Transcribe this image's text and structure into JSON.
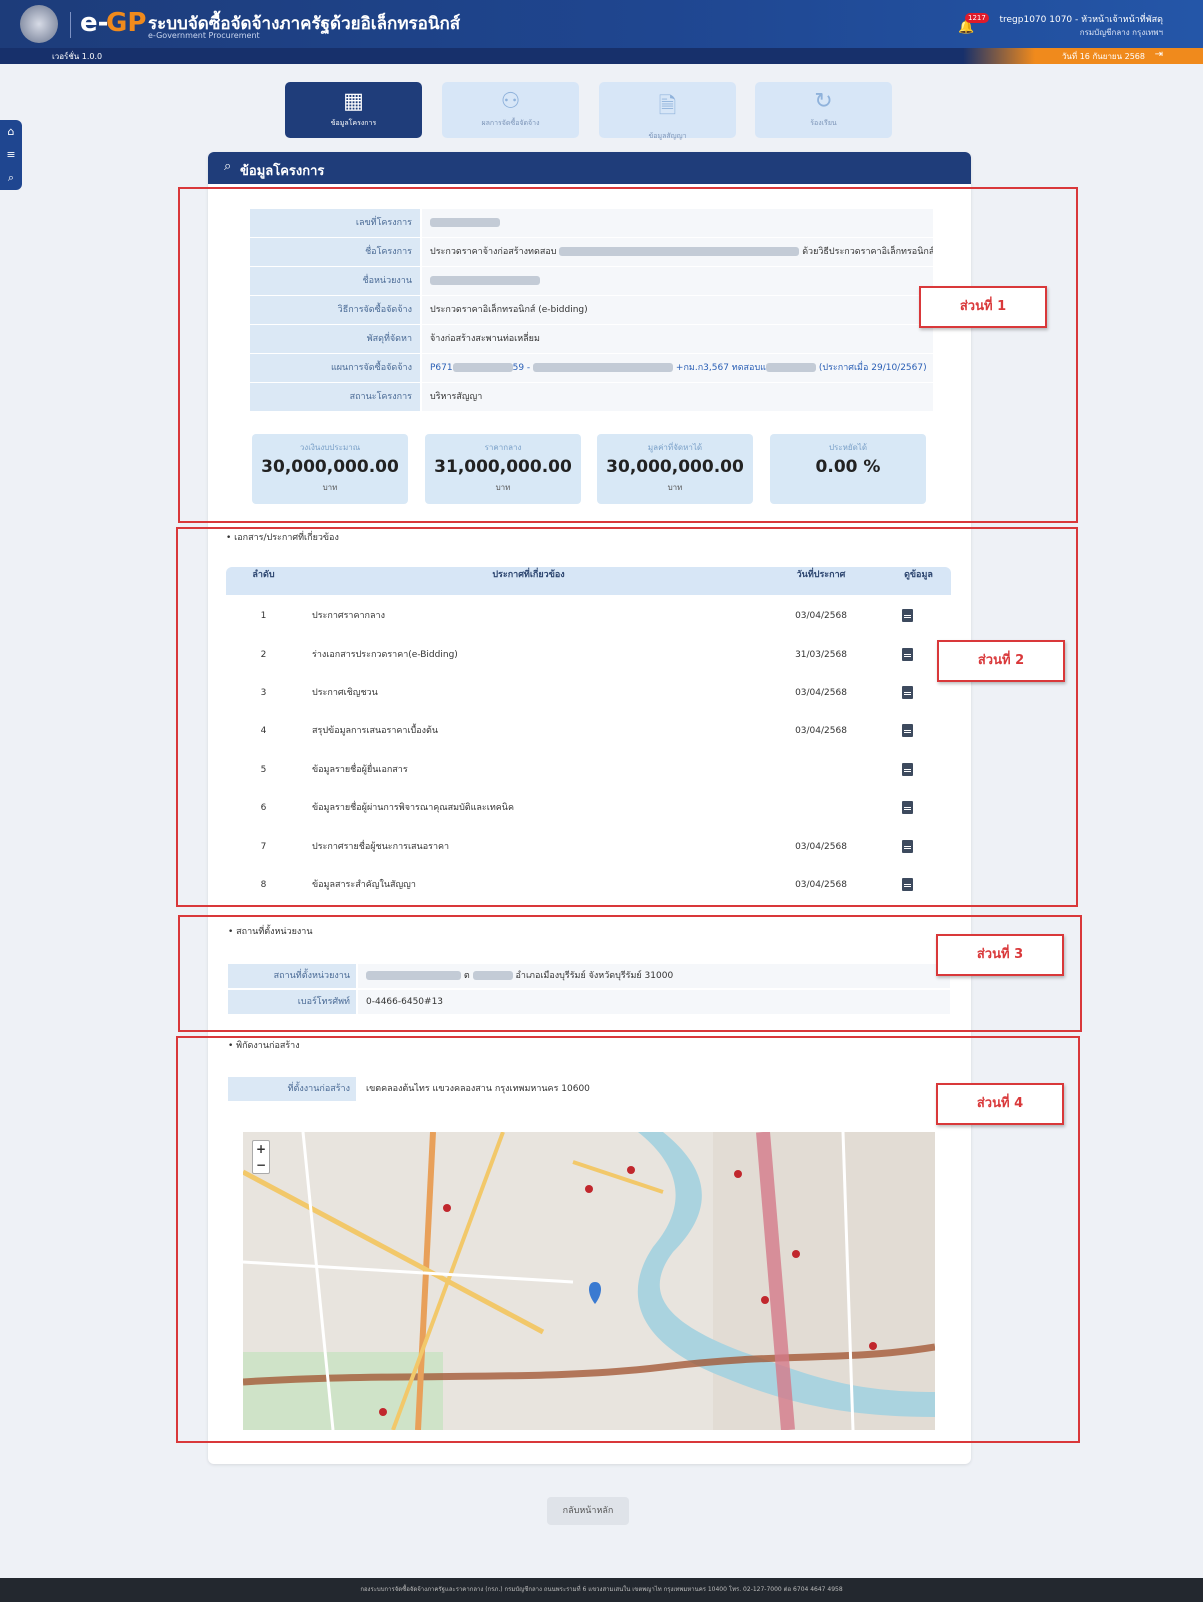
{
  "header": {
    "logo_e": "e-",
    "logo_gp": "GP",
    "title": "ระบบจัดซื้อจัดจ้างภาครัฐด้วยอิเล็กทรอนิกส์",
    "subtitle": "e-Government Procurement",
    "version": "เวอร์ชั่น 1.0.0",
    "notification_count": "1217",
    "user_line1": "tregp1070 1070 - หัวหน้าเจ้าหน้าที่พัสดุ",
    "user_line2": "กรมบัญชีกลาง กรุงเทพฯ",
    "date": "วันที่ 16 กันยายน 2568"
  },
  "tabs": [
    {
      "label": "ข้อมูลโครงการ",
      "icon": "building-icon"
    },
    {
      "label": "ผลการจัดซื้อจัดจ้าง",
      "icon": "users-icon"
    },
    {
      "label": "ข้อมูลสัญญา",
      "icon": "document-icon"
    },
    {
      "label": "ร้องเรียน",
      "icon": "complaint-icon"
    }
  ],
  "card_title": "ข้อมูลโครงการ",
  "project_info": {
    "rows": [
      {
        "label": "เลขที่โครงการ",
        "value": ""
      },
      {
        "label": "ชื่อโครงการ",
        "value_start": "ประกวดราคาจ้างก่อสร้างทดสอบ",
        "value_end": "ด้วยวิธีประกวดราคาอิเล็กทรอนิกส์ (e-bidding)"
      },
      {
        "label": "ชื่อหน่วยงาน",
        "value": ""
      },
      {
        "label": "วิธีการจัดซื้อจัดจ้าง",
        "value": "ประกวดราคาอิเล็กทรอนิกส์ (e-bidding)"
      },
      {
        "label": "พัสดุที่จัดหา",
        "value": "จ้างก่อสร้างสะพานท่อเหลี่ยม"
      },
      {
        "label": "แผนการจัดซื้อจัดจ้าง",
        "value_start": "P671",
        "value_mid": "59 -",
        "value_end": "+กม.ก3,567 ทดสอบแ",
        "value_tail": "(ประกาศเมื่อ 29/10/2567)"
      },
      {
        "label": "สถานะโครงการ",
        "value": "บริหารสัญญา"
      }
    ]
  },
  "summary": [
    {
      "label": "วงเงินงบประมาณ",
      "value": "30,000,000.00",
      "unit": "บาท"
    },
    {
      "label": "ราคากลาง",
      "value": "31,000,000.00",
      "unit": "บาท"
    },
    {
      "label": "มูลค่าที่จัดหาได้",
      "value": "30,000,000.00",
      "unit": "บาท"
    },
    {
      "label": "ประหยัดได้",
      "value": "0.00 %",
      "unit": ""
    }
  ],
  "sections": {
    "docs": "• เอกสาร/ประกาศที่เกี่ยวข้อง",
    "location": "• สถานที่ตั้งหน่วยงาน",
    "site": "• พิกัดงานก่อสร้าง"
  },
  "part_labels": [
    "ส่วนที่ 1",
    "ส่วนที่ 2",
    "ส่วนที่ 3",
    "ส่วนที่ 4"
  ],
  "doc_table": {
    "headers": [
      "ลำดับ",
      "ประกาศที่เกี่ยวข้อง",
      "วันที่ประกาศ",
      "ดูข้อมูล"
    ],
    "rows": [
      {
        "no": "1",
        "title": "ประกาศราคากลาง",
        "date": "03/04/2568"
      },
      {
        "no": "2",
        "title": "ร่างเอกสารประกวดราคา(e-Bidding)",
        "date": "31/03/2568"
      },
      {
        "no": "3",
        "title": "ประกาศเชิญชวน",
        "date": "03/04/2568"
      },
      {
        "no": "4",
        "title": "สรุปข้อมูลการเสนอราคาเบื้องต้น",
        "date": "03/04/2568"
      },
      {
        "no": "5",
        "title": "ข้อมูลรายชื่อผู้ยื่นเอกสาร",
        "date": ""
      },
      {
        "no": "6",
        "title": "ข้อมูลรายชื่อผู้ผ่านการพิจารณาคุณสมบัติและเทคนิค",
        "date": ""
      },
      {
        "no": "7",
        "title": "ประกาศรายชื่อผู้ชนะการเสนอราคา",
        "date": "03/04/2568"
      },
      {
        "no": "8",
        "title": "ข้อมูลสาระสำคัญในสัญญา",
        "date": "03/04/2568"
      }
    ]
  },
  "location": {
    "address_label": "สถานที่ตั้งหน่วยงาน",
    "address_mid": "ต",
    "address_end": "อำเภอเมืองบุรีรัมย์ จังหวัดบุรีรัมย์ 31000",
    "phone_label": "เบอร์โทรศัพท์",
    "phone": "0-4466-6450#13"
  },
  "site": {
    "label": "ที่ตั้งงานก่อสร้าง",
    "value": "เขตคลองต้นไทร แขวงคลองสาน กรุงเทพมหานคร 10600"
  },
  "map": {
    "zoom_in": "+",
    "zoom_out": "−"
  },
  "back_button": "กลับหน้าหลัก",
  "footer": "กองระบบการจัดซื้อจัดจ้างภาครัฐและราคากลาง (กรภ.) กรมบัญชีกลาง ถนนพระรามที่ 6 แขวงสามเสนใน เขตพญาไท กรุงเทพมหานคร 10400 โทร. 02-127-7000 ต่อ 6704 4647 4958",
  "colors": {
    "primary": "#1f3d7a",
    "accent": "#f08a1c",
    "annotation": "#d9383a"
  }
}
